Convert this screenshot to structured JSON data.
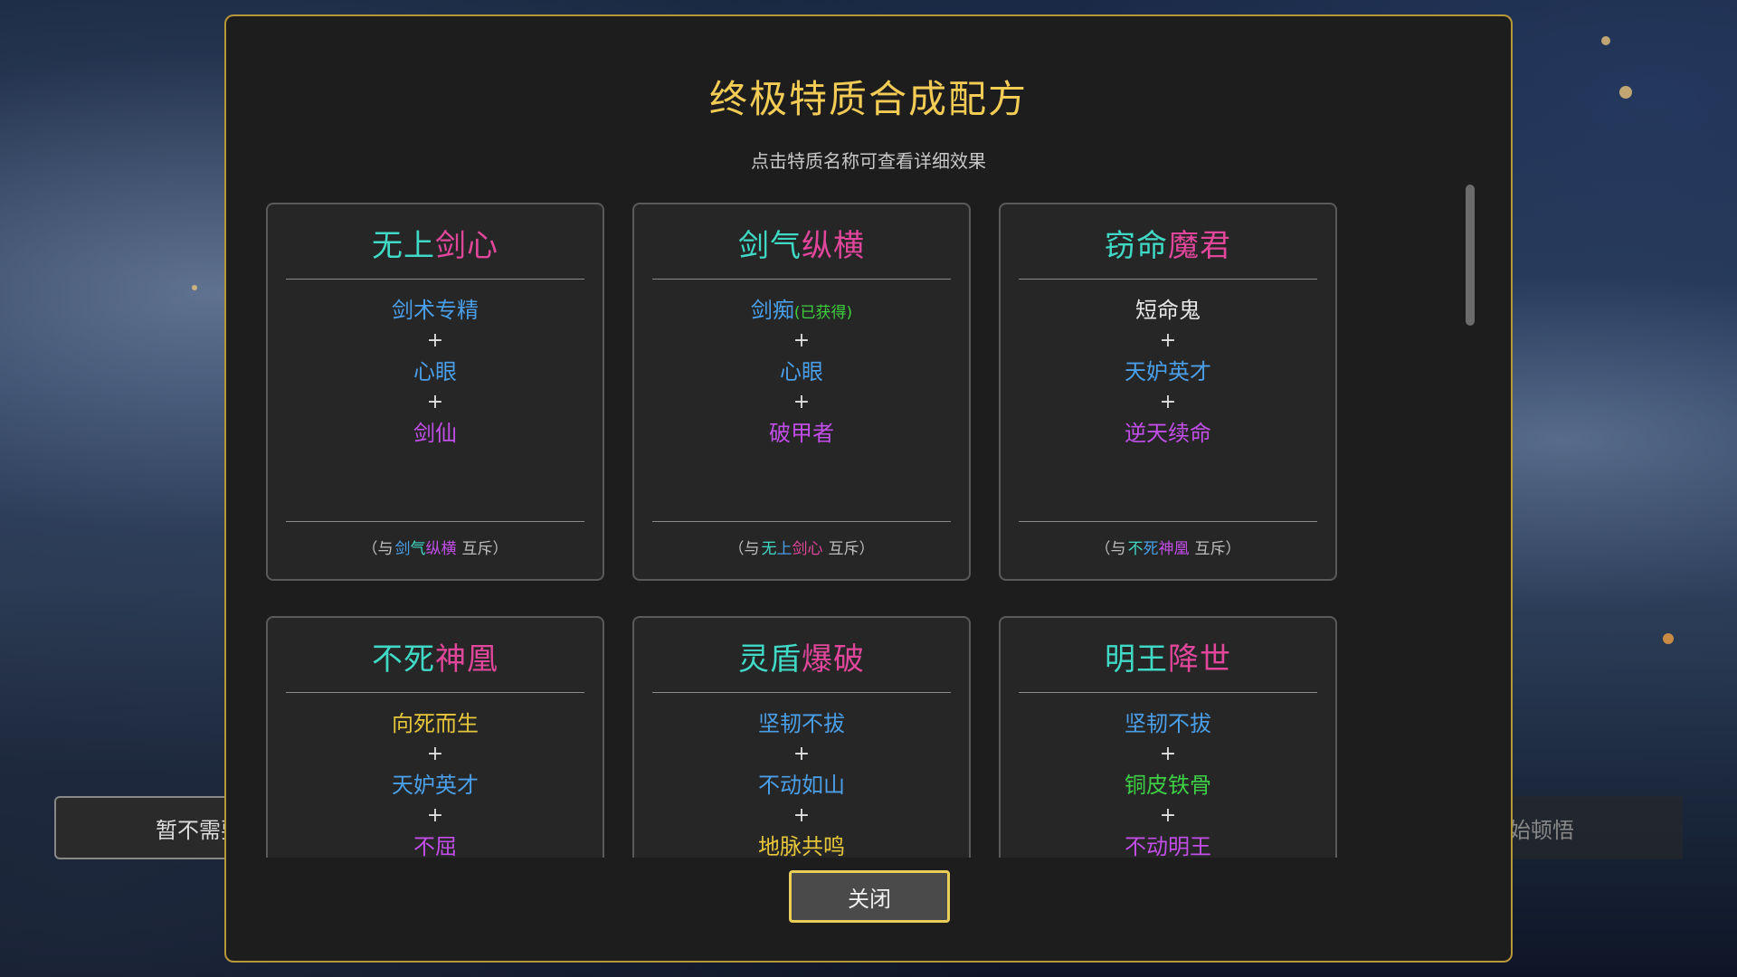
{
  "background": {
    "left_button": "暂不需要",
    "right_button": "开始顿悟"
  },
  "modal": {
    "title": "终极特质合成配方",
    "subtitle": "点击特质名称可查看详细效果",
    "close_label": "关闭"
  },
  "cards": [
    {
      "title": [
        {
          "text": "无上",
          "color": "#40d9c6"
        },
        {
          "text": "剑心",
          "color": "#e0479a"
        }
      ],
      "ingredients": [
        {
          "name": "剑术专精",
          "color": "#4a9fe8"
        },
        {
          "name": "心眼",
          "color": "#4a9fe8"
        },
        {
          "name": "剑仙",
          "color": "#c24ee8"
        }
      ],
      "exclusive_prefix": "（与",
      "exclusive_name": [
        {
          "text": "剑",
          "color": "#4a9fe8"
        },
        {
          "text": "气",
          "color": "#40d9c6"
        },
        {
          "text": "纵横",
          "color": "#c24ee8"
        }
      ],
      "exclusive_suffix": "互斥）"
    },
    {
      "title": [
        {
          "text": "剑气",
          "color": "#40d9c6"
        },
        {
          "text": "纵横",
          "color": "#e0479a"
        }
      ],
      "ingredients": [
        {
          "name": "剑痴",
          "color": "#4a9fe8",
          "note": "(已获得)"
        },
        {
          "name": "心眼",
          "color": "#4a9fe8"
        },
        {
          "name": "破甲者",
          "color": "#c24ee8"
        }
      ],
      "exclusive_prefix": "（与",
      "exclusive_name": [
        {
          "text": "无",
          "color": "#40d9c6"
        },
        {
          "text": "上",
          "color": "#4a9fe8"
        },
        {
          "text": "剑心",
          "color": "#e0479a"
        }
      ],
      "exclusive_suffix": "互斥）"
    },
    {
      "title": [
        {
          "text": "窃命",
          "color": "#40d9c6"
        },
        {
          "text": "魔君",
          "color": "#e0479a"
        }
      ],
      "ingredients": [
        {
          "name": "短命鬼",
          "color": "#e8e8e8"
        },
        {
          "name": "天妒英才",
          "color": "#4a9fe8"
        },
        {
          "name": "逆天续命",
          "color": "#c24ee8"
        }
      ],
      "exclusive_prefix": "（与",
      "exclusive_name": [
        {
          "text": "不",
          "color": "#40d9c6"
        },
        {
          "text": "死",
          "color": "#4a9fe8"
        },
        {
          "text": "神凰",
          "color": "#c24ee8"
        }
      ],
      "exclusive_suffix": "互斥）"
    },
    {
      "title": [
        {
          "text": "不死",
          "color": "#40d9c6"
        },
        {
          "text": "神凰",
          "color": "#e0479a"
        }
      ],
      "ingredients": [
        {
          "name": "向死而生",
          "color": "#e6c63a"
        },
        {
          "name": "天妒英才",
          "color": "#4a9fe8"
        },
        {
          "name": "不屈",
          "color": "#c24ee8"
        }
      ]
    },
    {
      "title": [
        {
          "text": "灵盾",
          "color": "#40d9c6"
        },
        {
          "text": "爆破",
          "color": "#e0479a"
        }
      ],
      "ingredients": [
        {
          "name": "坚韧不拔",
          "color": "#4a9fe8"
        },
        {
          "name": "不动如山",
          "color": "#4a9fe8"
        },
        {
          "name": "地脉共鸣",
          "color": "#e6c63a"
        }
      ]
    },
    {
      "title": [
        {
          "text": "明王",
          "color": "#40d9c6"
        },
        {
          "text": "降世",
          "color": "#e0479a"
        }
      ],
      "ingredients": [
        {
          "name": "坚韧不拔",
          "color": "#4a9fe8"
        },
        {
          "name": "铜皮铁骨",
          "color": "#3fcf45"
        },
        {
          "name": "不动明王",
          "color": "#c24ee8"
        }
      ]
    }
  ],
  "plus_symbol": "+"
}
